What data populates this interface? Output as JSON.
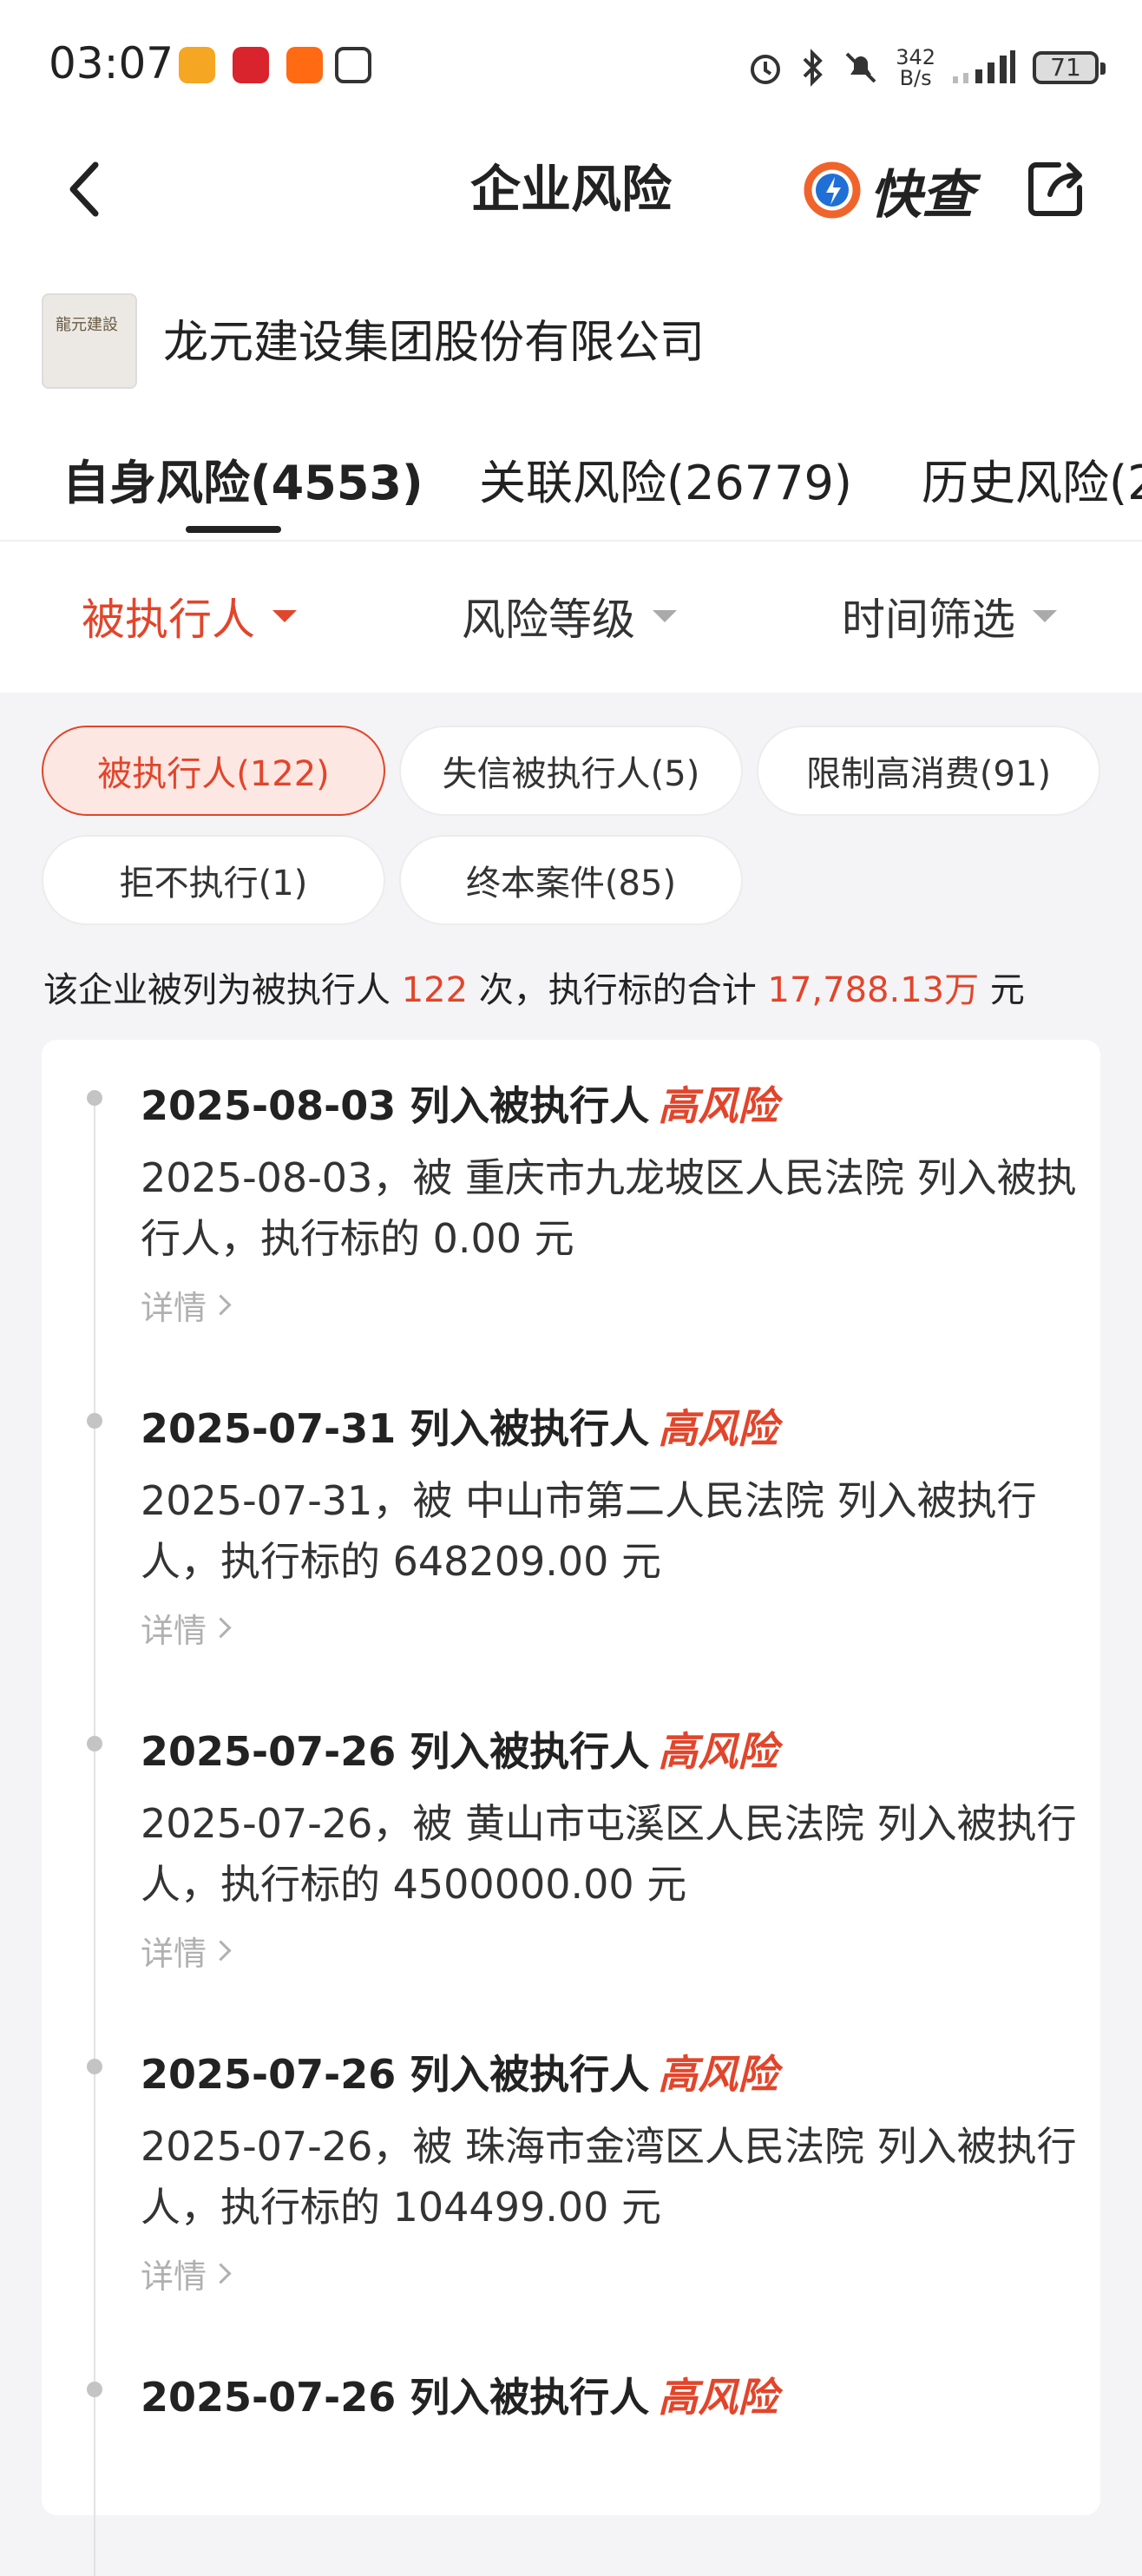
{
  "status_bar": {
    "time": "03:07",
    "net_speed_value": "342",
    "net_speed_unit": "B/s",
    "battery": "71",
    "icons": [
      "alarm-icon",
      "bluetooth-icon",
      "mute-icon",
      "signal-icon"
    ],
    "app_icons": [
      "app-icon-1",
      "app-icon-2",
      "taobao-icon",
      "nfc-icon"
    ]
  },
  "nav": {
    "title": "企业风险",
    "brand": "快查",
    "brand_color": "#f0642b"
  },
  "company": {
    "name": "龙元建设集团股份有限公司",
    "logo_text": "龍元建設"
  },
  "tabs": [
    {
      "label": "自身风险(4553)",
      "active": true
    },
    {
      "label": "关联风险(26779)",
      "active": false
    },
    {
      "label": "历史风险(2",
      "active": false
    }
  ],
  "filters": [
    {
      "label": "被执行人",
      "active": true
    },
    {
      "label": "风险等级",
      "active": false
    },
    {
      "label": "时间筛选",
      "active": false
    }
  ],
  "chips": [
    {
      "label": "被执行人(122)",
      "active": true
    },
    {
      "label": "失信被执行人(5)",
      "active": false
    },
    {
      "label": "限制高消费(91)",
      "active": false
    },
    {
      "label": "拒不执行(1)",
      "active": false
    },
    {
      "label": "终本案件(85)",
      "active": false
    }
  ],
  "summary": {
    "prefix": "该企业被列为被执行人",
    "count": "122",
    "middle": "次，执行标的合计",
    "amount": "17,788.13万",
    "suffix": "元"
  },
  "entries": [
    {
      "title": "2025-08-03 列入被执行人",
      "tag": "高风险",
      "desc": "2025-08-03，被 重庆市九龙坡区人民法院 列入被执行人，执行标的 0.00 元",
      "detail": "详情"
    },
    {
      "title": "2025-07-31 列入被执行人",
      "tag": "高风险",
      "desc": "2025-07-31，被 中山市第二人民法院 列入被执行人，执行标的 648209.00 元",
      "detail": "详情"
    },
    {
      "title": "2025-07-26 列入被执行人",
      "tag": "高风险",
      "desc": "2025-07-26，被 黄山市屯溪区人民法院 列入被执行人，执行标的 4500000.00 元",
      "detail": "详情"
    },
    {
      "title": "2025-07-26 列入被执行人",
      "tag": "高风险",
      "desc": "2025-07-26，被 珠海市金湾区人民法院 列入被执行人，执行标的 104499.00 元",
      "detail": "详情"
    },
    {
      "title": "2025-07-26 列入被执行人",
      "tag": "高风险",
      "desc": "",
      "detail": ""
    }
  ]
}
